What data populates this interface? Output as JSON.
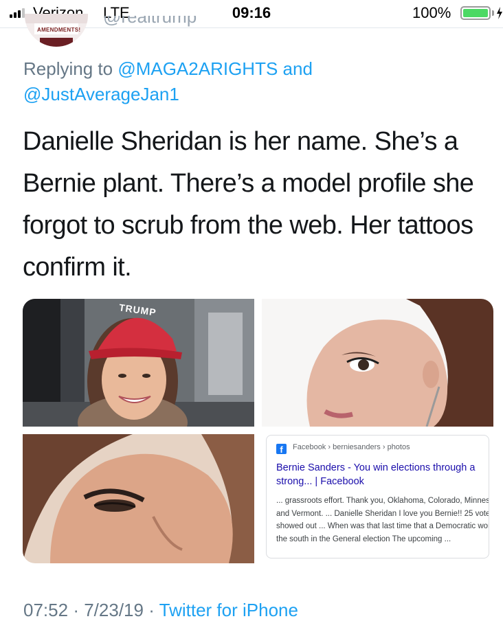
{
  "status_bar": {
    "carrier": "Verizon",
    "network": "LTE",
    "time": "09:16",
    "battery_percent": "100%",
    "battery_level": 1.0,
    "signal_bars_active": 3,
    "signal_bars_total": 4
  },
  "author": {
    "avatar_text": "AMENDMENTS!",
    "avatar_icon": "profile-avatar"
  },
  "reply": {
    "prefix": "Replying to",
    "mention1": "@MAGA2ARIGHTS",
    "conjunction": "and",
    "mention2": "@JustAverageJan1"
  },
  "tweet": {
    "text": "Danielle Sheridan is her name. She’s a Bernie plant. There’s a model profile she forgot to scrub from the web. Her tattoos confirm it.",
    "media": [
      {
        "icon": "photo-woman-red-cap",
        "cap_text": "TRUMP"
      },
      {
        "icon": "photo-woman-profile-closeup"
      },
      {
        "icon": "photo-woman-face-closeup"
      },
      {
        "icon": "search-result-screenshot",
        "breadcrumb": "Facebook › berniesanders › photos",
        "title": "Bernie Sanders - You win elections through a strong... | Facebook",
        "snippet": "... grassroots effort. Thank you, Oklahoma, Colorado, Minnesota and Vermont. ... Danielle Sheridan I love you Bernie!! 25 voters showed out ... When was that last time that a Democratic won the south in the General election The upcoming ..."
      }
    ]
  },
  "footer": {
    "time": "07:52",
    "sep1": "·",
    "date": "7/23/19",
    "sep2": "·",
    "source": "Twitter for iPhone"
  },
  "colors": {
    "link": "#1da1f2",
    "secondary_text": "#657786",
    "body_text": "#14171a",
    "battery": "#4cd964",
    "google_link": "#1a0dab"
  }
}
